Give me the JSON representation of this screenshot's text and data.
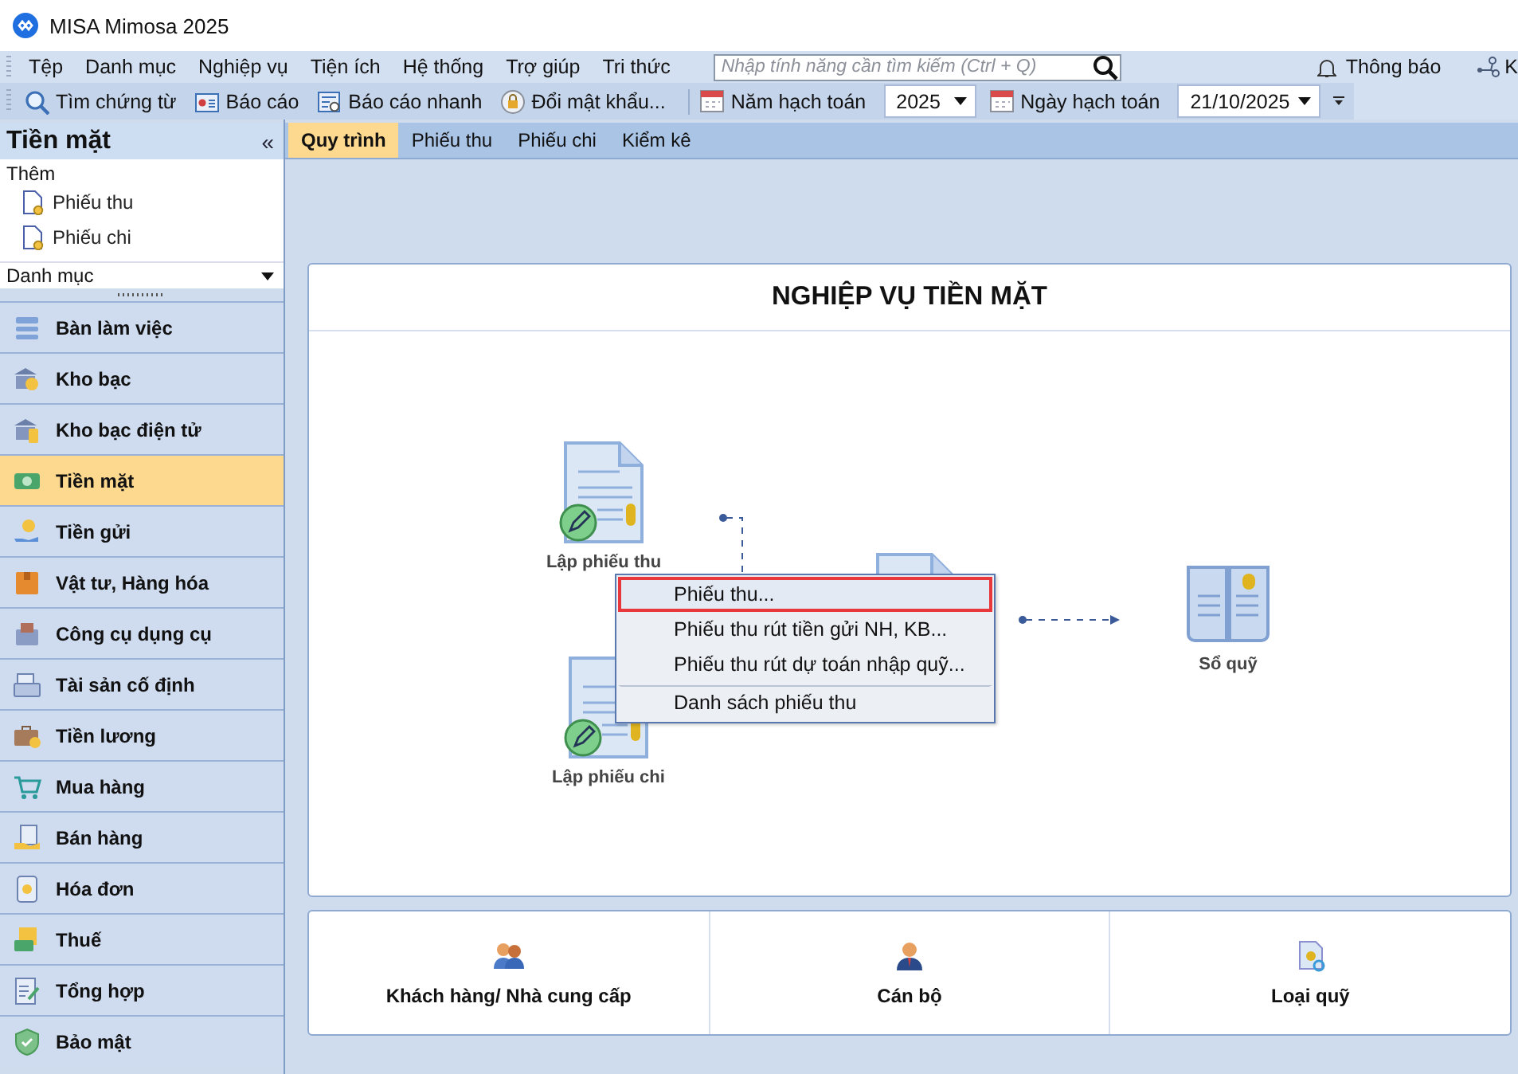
{
  "window": {
    "title": "MISA Mimosa 2025"
  },
  "menu_bar": {
    "items": [
      "Tệp",
      "Danh mục",
      "Nghiệp vụ",
      "Tiện ích",
      "Hệ thống",
      "Trợ giúp",
      "Tri thức"
    ],
    "search": {
      "placeholder": "Nhập tính năng cần tìm kiếm (Ctrl + Q)"
    },
    "notifications": "Thông báo",
    "connect": "K"
  },
  "toolbar": {
    "buttons": [
      "Tìm chứng từ",
      "Báo cáo",
      "Báo cáo nhanh",
      "Đổi mật khẩu..."
    ],
    "year": {
      "label": "Năm hạch toán",
      "value": "2025"
    },
    "date": {
      "label": "Ngày hạch toán",
      "value": "21/10/2025"
    }
  },
  "sidebar": {
    "title": "Tiền mặt",
    "collapse": "«",
    "add_heading": "Thêm",
    "add_items": [
      "Phiếu thu",
      "Phiếu chi"
    ],
    "category": "Danh mục",
    "modules": [
      {
        "label": "Bàn làm việc",
        "selected": false
      },
      {
        "label": "Kho bạc",
        "selected": false
      },
      {
        "label": "Kho bạc điện tử",
        "selected": false
      },
      {
        "label": "Tiền mặt",
        "selected": true
      },
      {
        "label": "Tiền gửi",
        "selected": false
      },
      {
        "label": "Vật tư, Hàng hóa",
        "selected": false
      },
      {
        "label": "Công cụ dụng cụ",
        "selected": false
      },
      {
        "label": "Tài sản cố định",
        "selected": false
      },
      {
        "label": "Tiền lương",
        "selected": false
      },
      {
        "label": "Mua hàng",
        "selected": false
      },
      {
        "label": "Bán hàng",
        "selected": false
      },
      {
        "label": "Hóa đơn",
        "selected": false
      },
      {
        "label": "Thuế",
        "selected": false
      },
      {
        "label": "Tổng hợp",
        "selected": false
      },
      {
        "label": "Bảo mật",
        "selected": false
      }
    ]
  },
  "tabs": [
    {
      "label": "Quy trình",
      "selected": true
    },
    {
      "label": "Phiếu thu",
      "selected": false
    },
    {
      "label": "Phiếu chi",
      "selected": false
    },
    {
      "label": "Kiểm kê",
      "selected": false
    }
  ],
  "workflow": {
    "title": "NGHIỆP VỤ TIỀN MẶT",
    "steps": [
      "Lập phiếu thu",
      "Lập phiếu chi",
      "Sổ quỹ"
    ]
  },
  "categories": [
    "Khách hàng/ Nhà cung cấp",
    "Cán bộ",
    "Loại quỹ"
  ],
  "context_menu": {
    "items": [
      {
        "label": "Phiếu thu...",
        "selected": true,
        "separated": false
      },
      {
        "label": "Phiếu thu rút tiền gửi NH, KB...",
        "selected": false,
        "separated": false
      },
      {
        "label": "Phiếu thu rút dự toán nhập quỹ...",
        "selected": false,
        "separated": false
      },
      {
        "label": "Danh sách phiếu thu",
        "selected": false,
        "separated": true
      }
    ]
  }
}
